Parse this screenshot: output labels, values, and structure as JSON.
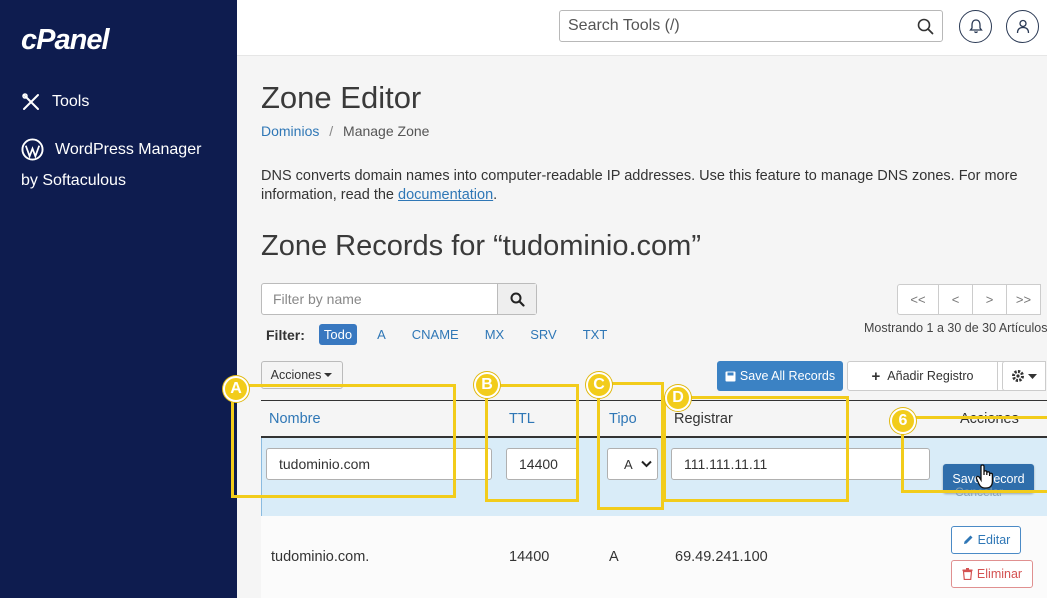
{
  "sidebar": {
    "logo": "cPanel",
    "items": [
      {
        "label": "Tools",
        "icon": "tools-icon"
      },
      {
        "label": "WordPress Manager",
        "label2": "by Softaculous",
        "icon": "wordpress-icon"
      }
    ]
  },
  "topbar": {
    "search_placeholder": "Search Tools (/)",
    "icons": [
      "search-icon",
      "bell-icon",
      "user-icon"
    ]
  },
  "page": {
    "title": "Zone Editor",
    "breadcrumb": {
      "parent": "Dominios",
      "separator": "/",
      "current": "Manage Zone"
    },
    "description": "DNS converts domain names into computer-readable IP addresses. Use this feature to manage DNS zones. For more information, read the ",
    "description_link": "documentation",
    "description_end": ".",
    "zone_title": "Zone Records for “tudominio.com”"
  },
  "filter": {
    "placeholder": "Filter by name",
    "label": "Filter:",
    "options": [
      "Todo",
      "A",
      "CNAME",
      "MX",
      "SRV",
      "TXT"
    ],
    "active": "Todo"
  },
  "pager": {
    "buttons": [
      "<<",
      "<",
      ">",
      ">>"
    ],
    "showing": "Mostrando 1 a 30 de 30 Artículos"
  },
  "toolbar": {
    "actions_label": "Acciones",
    "save_all_label": "Save All Records",
    "add_record_label": "Añadir Registro"
  },
  "table": {
    "headers": {
      "name": "Nombre",
      "ttl": "TTL",
      "type": "Tipo",
      "record": "Registrar",
      "actions": "Acciones"
    },
    "edit_row": {
      "name": "tudominio.com",
      "ttl": "14400",
      "type": "A",
      "record": "111.111.11.11",
      "save_label": "Save Record",
      "cancel_label": "Cancelar"
    },
    "rows": [
      {
        "name": "tudominio.com.",
        "ttl": "14400",
        "type": "A",
        "record": "69.49.241.100",
        "edit_label": "Editar",
        "delete_label": "Eliminar"
      }
    ]
  },
  "annotations": {
    "color": "#f2cc1b",
    "labels": [
      "A",
      "B",
      "C",
      "D",
      "6"
    ]
  }
}
